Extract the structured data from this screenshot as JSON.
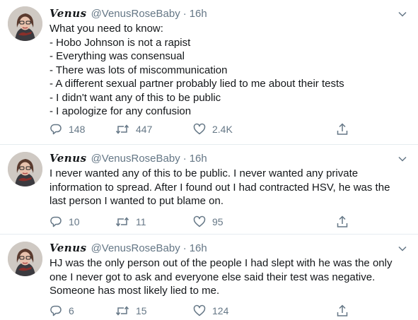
{
  "tweets": [
    {
      "display_name": "Venus",
      "handle": "@VenusRoseBaby",
      "separator": "·",
      "time": "16h",
      "lines": [
        "What you need to know:",
        "- Hobo Johnson is not a rapist",
        "- Everything was consensual",
        "- There was lots of miscommunication",
        "- A different sexual partner probably lied to me about their tests",
        "- I didn't want any of this to be public",
        "- I apologize for any confusion"
      ],
      "replies": "148",
      "retweets": "447",
      "likes": "2.4K"
    },
    {
      "display_name": "Venus",
      "handle": "@VenusRoseBaby",
      "separator": "·",
      "time": "16h",
      "lines": [
        "I never wanted any of this to be public. I never wanted any private",
        "information to spread. After I found out I had contracted HSV, he was the",
        "last person I wanted to put blame on."
      ],
      "replies": "10",
      "retweets": "11",
      "likes": "95"
    },
    {
      "display_name": "Venus",
      "handle": "@VenusRoseBaby",
      "separator": "·",
      "time": "16h",
      "lines": [
        "HJ was the only person out of the people I had slept with he was the only",
        "one I never got to ask and everyone else said their test was negative.",
        "Someone has most likely lied to me."
      ],
      "replies": "6",
      "retweets": "15",
      "likes": "124"
    }
  ],
  "icons": {
    "reply": "reply-icon",
    "retweet": "retweet-icon",
    "like": "heart-icon",
    "share": "share-icon",
    "menu": "chevron-down-icon"
  },
  "colors": {
    "text": "#14171a",
    "secondary": "#657786",
    "divider": "#e6ecf0"
  }
}
